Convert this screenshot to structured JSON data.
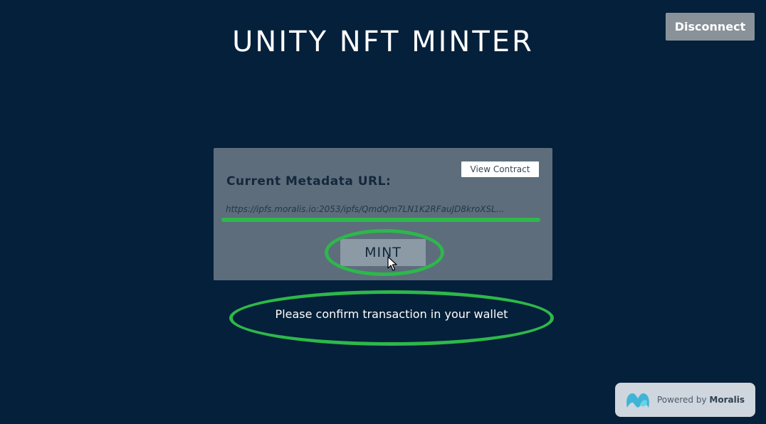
{
  "header": {
    "title": "UNITY NFT MINTER",
    "disconnect_label": "Disconnect"
  },
  "panel": {
    "view_contract_label": "View Contract",
    "metadata_label": "Current Metadata URL:",
    "metadata_url": "https://ipfs.moralis.io:2053/ipfs/QmdQm7LN1K2RFauJD8kroXSL...",
    "mint_label": "MINT"
  },
  "status": {
    "message": "Please confirm transaction in your wallet"
  },
  "footer": {
    "powered_prefix": "Powered by",
    "powered_brand": "Moralis"
  },
  "colors": {
    "background": "#05203a",
    "highlight": "#2db84b",
    "panel": "#5d6d7c"
  },
  "icons": {
    "cursor": "mouse-pointer-icon",
    "logo": "moralis-logo-icon"
  }
}
